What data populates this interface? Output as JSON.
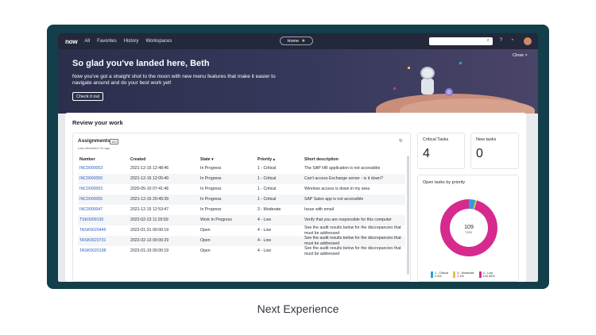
{
  "nav": {
    "logo": "now",
    "links": [
      "All",
      "Favorites",
      "History",
      "Workspaces"
    ],
    "home_label": "Home"
  },
  "banner": {
    "title": "So glad you've landed here, Beth",
    "message": "Now you've got a straight shot to the moon with new menu features that make it easier to navigate around and do your best work yet!",
    "button": "Check it out",
    "close": "Close ×"
  },
  "review": {
    "title": "Review your work"
  },
  "assignments": {
    "title": "Assignments",
    "badge": "120",
    "subtitle": "Last refreshed 7m ago",
    "columns": [
      "Number",
      "Created",
      "State ▾",
      "Priority ▴",
      "Short description"
    ],
    "rows": [
      {
        "number": "INC0000053",
        "created": "2021-12-15 12:48:46",
        "state": "In Progress",
        "priority": "1 - Critical",
        "desc": "The SAP HR application is not accessible"
      },
      {
        "number": "INC0000050",
        "created": "2021-12-15 12:05:40",
        "state": "In Progress",
        "priority": "1 - Critical",
        "desc": "Can't access Exchange server - is it down?"
      },
      {
        "number": "INC0000003",
        "created": "2020-05-10 07:41:46",
        "state": "In Progress",
        "priority": "1 - Critical",
        "desc": "Wireless access is down in my area"
      },
      {
        "number": "INC0000055",
        "created": "2021-12-15 20:49:39",
        "state": "In Progress",
        "priority": "1 - Critical",
        "desc": "SAP Sales app is not accessible"
      },
      {
        "number": "INC0000047",
        "created": "2021-12-15 12:53:47",
        "state": "In Progress",
        "priority": "3 - Moderate",
        "desc": "Issue with email"
      },
      {
        "number": "TSK0009130",
        "created": "2022-02-23 11:29:59",
        "state": "Work In Progress",
        "priority": "4 - Low",
        "desc": "Verify that you are responsible for this computer"
      },
      {
        "number": "TASK0020445",
        "created": "2022-01-31 00:00:19",
        "state": "Open",
        "priority": "4 - Low",
        "desc": "See the audit results below for the discrepancies that must be addressed"
      },
      {
        "number": "TASK0020731",
        "created": "2022-02-13 00:00:29",
        "state": "Open",
        "priority": "4 - Low",
        "desc": "See the audit results below for the discrepancies that must be addressed"
      },
      {
        "number": "TASK0020198",
        "created": "2022-01-19 00:00:19",
        "state": "Open",
        "priority": "4 - Low",
        "desc": "See the audit results below for the discrepancies that must be addressed"
      }
    ]
  },
  "metrics": {
    "critical": {
      "label": "Critical Tasks",
      "value": "4"
    },
    "new": {
      "label": "New tasks",
      "value": "0"
    }
  },
  "donut": {
    "title": "Open tasks by priority",
    "total": "109",
    "total_label": "TASK",
    "slices": [
      {
        "label": "1 - Critical",
        "count": "4",
        "pct": "4%",
        "value": 4,
        "color": "#2aa0d8"
      },
      {
        "label": "3 - Moderate",
        "count": "1",
        "pct": "1%",
        "value": 1,
        "color": "#f2b84b"
      },
      {
        "label": "4 - Low",
        "count": "104",
        "pct": "95%",
        "value": 104,
        "color": "#d62a8f"
      }
    ]
  },
  "caption": "Next Experience"
}
